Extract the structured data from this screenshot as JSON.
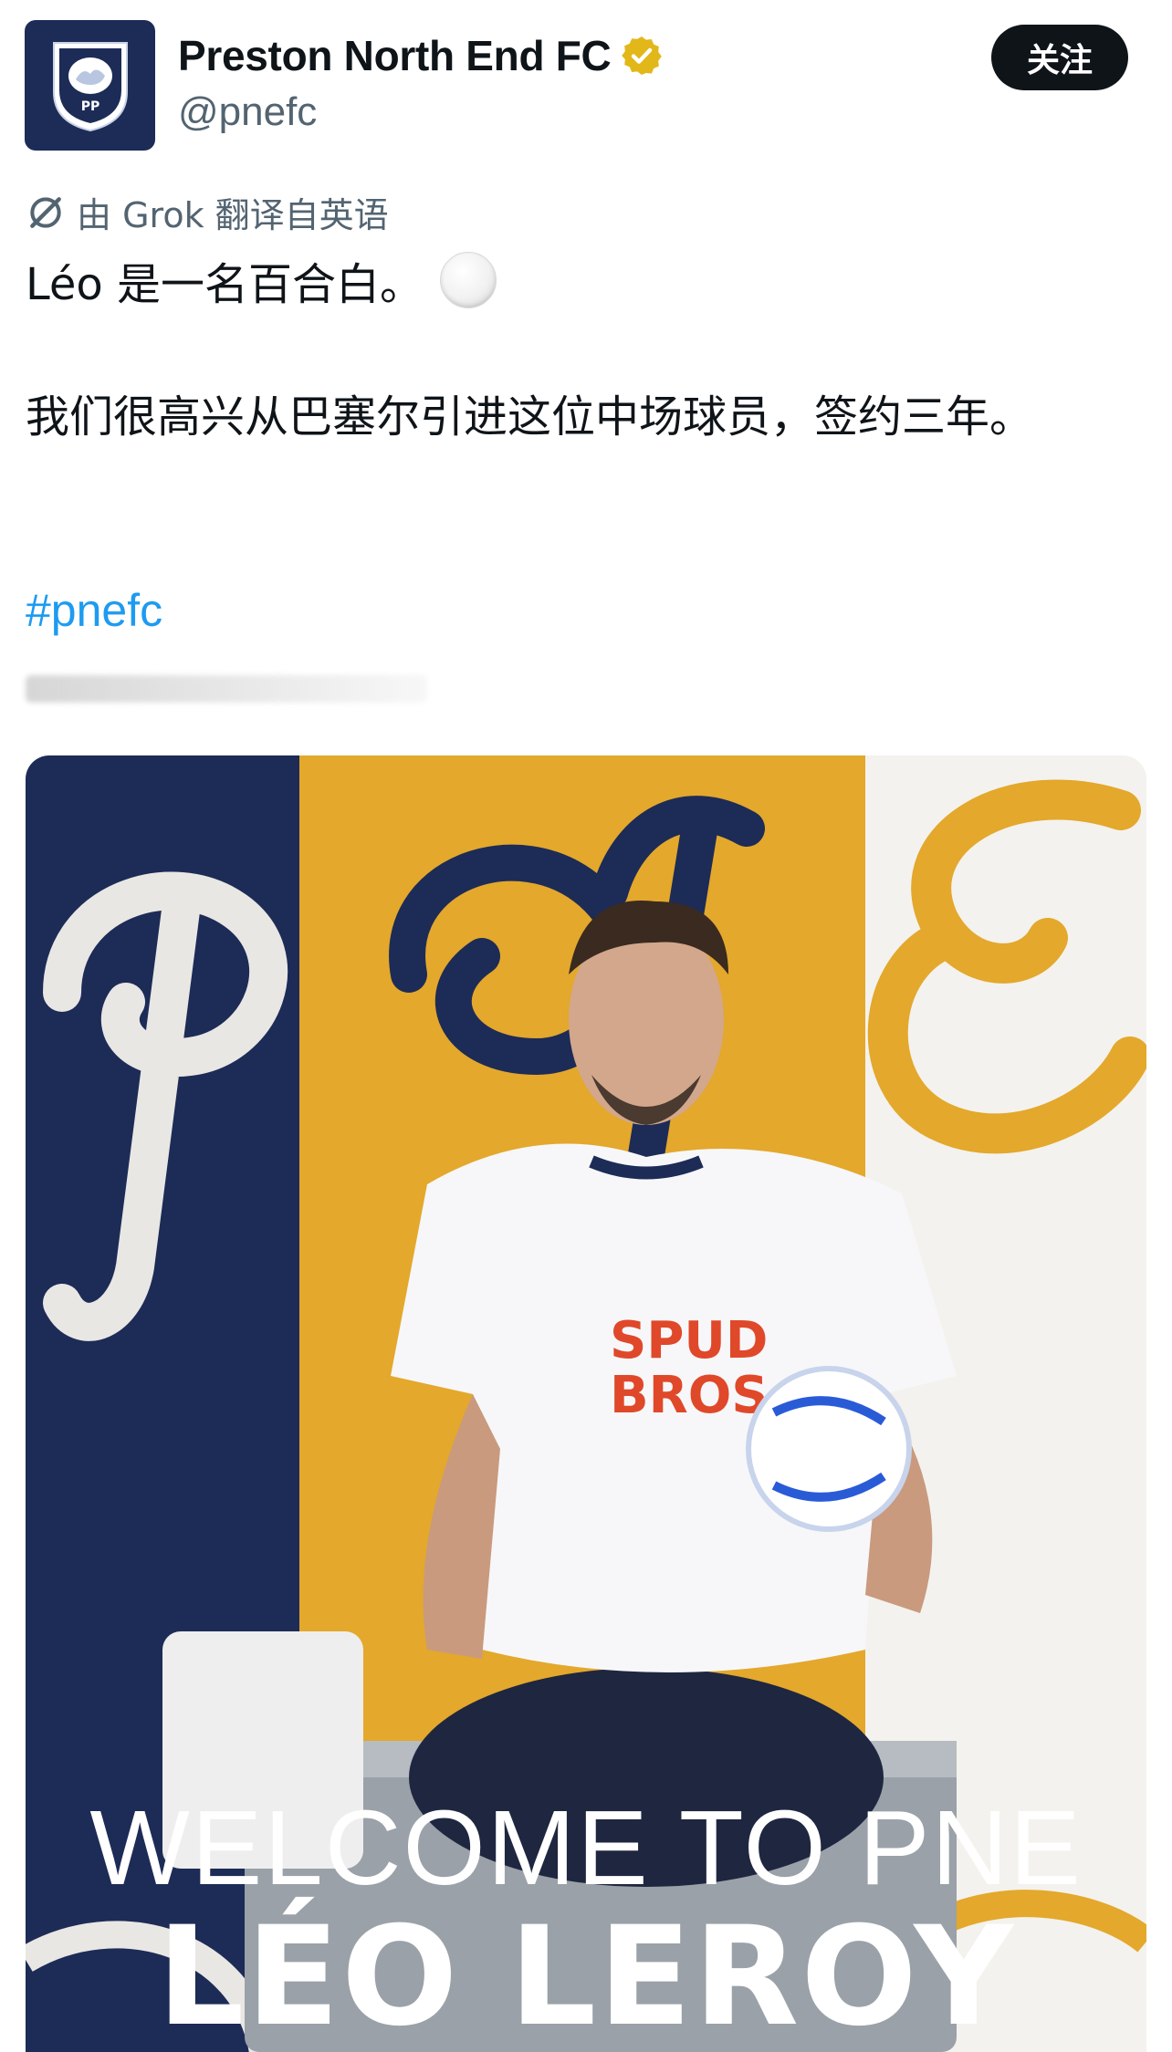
{
  "header": {
    "display_name": "Preston North End FC",
    "handle": "@pnefc",
    "follow_label": "关注",
    "verified_color": "#e2b719"
  },
  "translation": {
    "label": "由 Grok 翻译自英语",
    "icon": "grok-icon"
  },
  "tweet": {
    "line1": "Léo 是一名百合白。",
    "line1_emoji": "white-circle-icon",
    "line2": "我们很高兴从巴塞尔引进这位中场球员，签约三年。",
    "hashtag": "#pnefc"
  },
  "media": {
    "welcome_text": "WELCOME TO PNE",
    "player_name": "LÉO LEROY",
    "colors": {
      "navy": "#1d2b57",
      "gold": "#e3a82c",
      "white": "#f4f2ee"
    }
  }
}
